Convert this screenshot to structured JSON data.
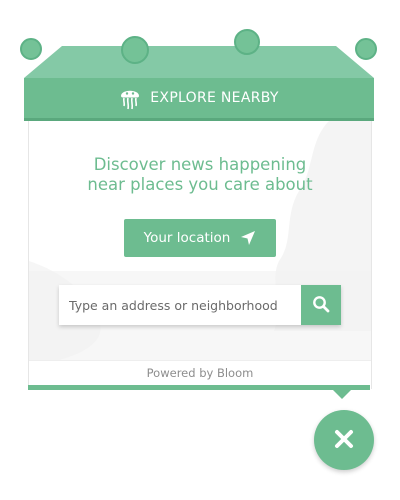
{
  "header": {
    "title": "EXPLORE NEARBY",
    "icon": "jellyfish-icon"
  },
  "main": {
    "headline_line1": "Discover news happening",
    "headline_line2": "near places you care about",
    "location_button": "Your location",
    "location_icon": "navigation-arrow-icon",
    "search_placeholder": "Type an address or neighborhood",
    "search_value": "",
    "search_icon": "search-icon"
  },
  "footer": {
    "powered_by": "Powered by Bloom"
  },
  "close_icon": "close-icon",
  "colors": {
    "accent": "#6dbc90",
    "accent_dark": "#5aa87d",
    "awning": "#84c9a6",
    "footer_text": "#8d8d8d"
  }
}
